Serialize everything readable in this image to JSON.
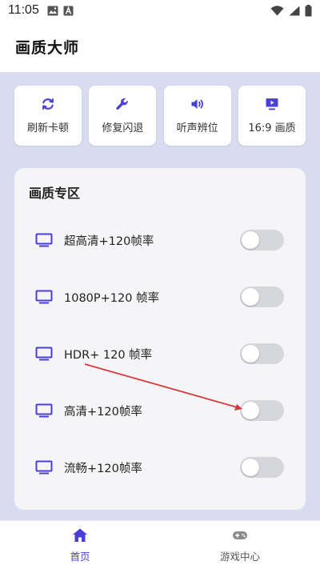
{
  "status_bar": {
    "time": "11:05"
  },
  "app_bar": {
    "title": "画质大师"
  },
  "quick_actions": [
    {
      "label": "刷新卡顿",
      "icon": "refresh-icon"
    },
    {
      "label": "修复闪退",
      "icon": "wrench-icon"
    },
    {
      "label": "听声辨位",
      "icon": "speaker-icon"
    },
    {
      "label": "16:9 画质",
      "icon": "monitor-play-icon"
    }
  ],
  "zone": {
    "title": "画质专区",
    "rows": [
      {
        "label": "超高清+120帧率",
        "enabled": false
      },
      {
        "label": "1080P+120 帧率",
        "enabled": false
      },
      {
        "label": "HDR+ 120 帧率",
        "enabled": false
      },
      {
        "label": "高清+120帧率",
        "enabled": false
      },
      {
        "label": "流畅+120帧率",
        "enabled": false
      }
    ]
  },
  "bottom_nav": [
    {
      "label": "首页",
      "icon": "home-icon",
      "active": true
    },
    {
      "label": "游戏中心",
      "icon": "gamepad-icon",
      "active": false
    }
  ],
  "colors": {
    "accent": "#4a3fd8",
    "content_bg": "#d9dcf0",
    "toggle_off": "#d5d7dd",
    "annotation_arrow": "#d63a3a"
  }
}
